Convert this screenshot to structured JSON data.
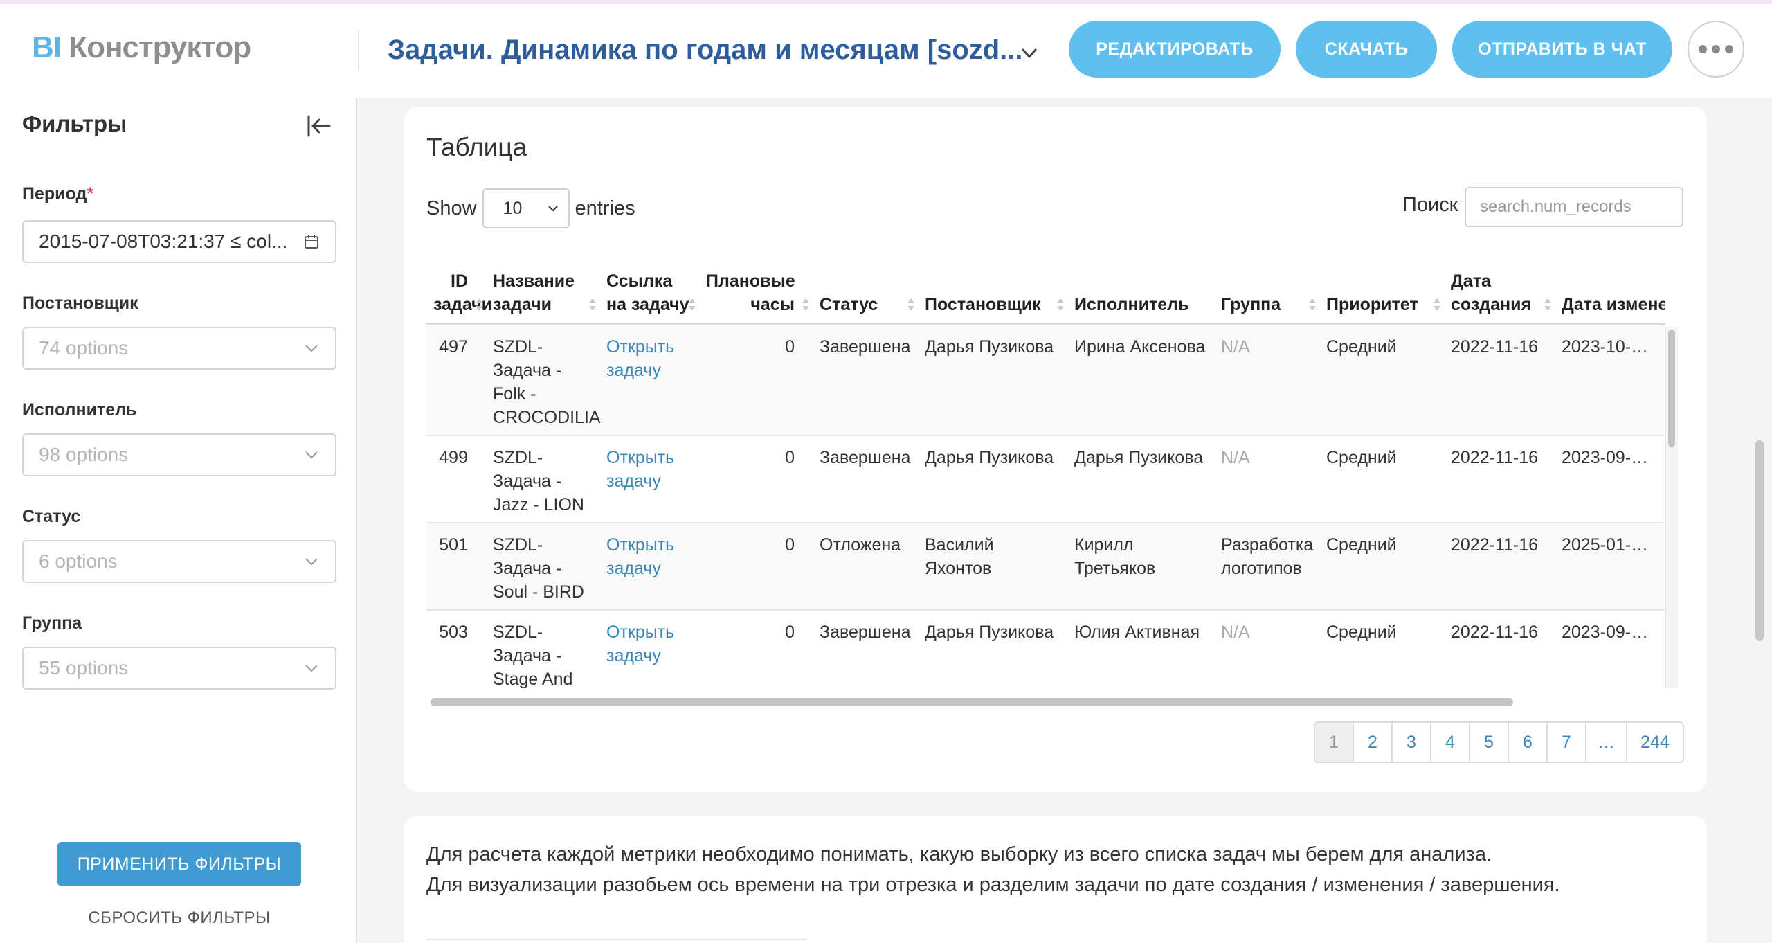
{
  "app": {
    "logo_bi": "BI",
    "logo_rest": "Конструктор",
    "dashboard_title": "Задачи. Динамика по годам и месяцам [sozd..."
  },
  "header": {
    "edit_label": "РЕДАКТИРОВАТЬ",
    "download_label": "СКАЧАТЬ",
    "send_label": "ОТПРАВИТЬ В ЧАТ"
  },
  "sidebar": {
    "title": "Фильтры",
    "period_label": "Период",
    "period_required": "*",
    "period_value": "2015-07-08T03:21:37 ≤ col...",
    "reporter_label": "Постановщик",
    "reporter_placeholder": "74 options",
    "assignee_label": "Исполнитель",
    "assignee_placeholder": "98 options",
    "status_label": "Статус",
    "status_placeholder": "6 options",
    "group_label": "Группа",
    "group_placeholder": "55 options",
    "apply_label": "ПРИМЕНИТЬ ФИЛЬТРЫ",
    "reset_label": "СБРОСИТЬ ФИЛЬТРЫ"
  },
  "table_card": {
    "title": "Таблица",
    "show_label": "Show",
    "show_value": "10",
    "entries_label": "entries",
    "search_label": "Поиск",
    "search_placeholder": "search.num_records",
    "columns": [
      "ID задачи",
      "Название задачи",
      "Ссылка на задачу",
      "Плановые часы",
      "Статус",
      "Постановщик",
      "Исполнитель",
      "Группа",
      "Приоритет",
      "Дата создания",
      "Дата изменения"
    ],
    "rows": [
      {
        "id": "497",
        "name": "SZDL-Задача - Folk - CROCODILIA",
        "link": "Открыть задачу",
        "hours": "0",
        "status": "Завершена",
        "reporter": "Дарья Пузикова",
        "assignee": "Ирина Аксенова",
        "group": "N/A",
        "priority": "Средний",
        "created": "2022-11-16",
        "modified": "2023-10-…"
      },
      {
        "id": "499",
        "name": "SZDL-Задача - Jazz - LION",
        "link": "Открыть задачу",
        "hours": "0",
        "status": "Завершена",
        "reporter": "Дарья Пузикова",
        "assignee": "Дарья Пузикова",
        "group": "N/A",
        "priority": "Средний",
        "created": "2022-11-16",
        "modified": "2023-09-…"
      },
      {
        "id": "501",
        "name": "SZDL-Задача - Soul - BIRD",
        "link": "Открыть задачу",
        "hours": "0",
        "status": "Отложена",
        "reporter": "Василий Яхонтов",
        "assignee": "Кирилл Третьяков",
        "group": "Разработка логотипов",
        "priority": "Средний",
        "created": "2022-11-16",
        "modified": "2025-01-…"
      },
      {
        "id": "503",
        "name": "SZDL-Задача - Stage And Screen",
        "link": "Открыть задачу",
        "hours": "0",
        "status": "Завершена",
        "reporter": "Дарья Пузикова",
        "assignee": "Юлия Активная",
        "group": "N/A",
        "priority": "Средний",
        "created": "2022-11-16",
        "modified": "2023-09-…"
      }
    ],
    "pagination": [
      "1",
      "2",
      "3",
      "4",
      "5",
      "6",
      "7",
      "…",
      "244"
    ],
    "active_page": "1"
  },
  "description": {
    "line1": "Для расчета каждой метрики необходимо понимать, какую выборку из всего списка задач мы берем для анализа.",
    "line2": "Для визуализации разобьем ось времени на три отрезка и разделим задачи по дате создания / изменения / завершения."
  },
  "colors": {
    "accent": "#5fbfef",
    "apply": "#3f9bd2",
    "title": "#2d5d9a",
    "link": "#3a86b8"
  }
}
